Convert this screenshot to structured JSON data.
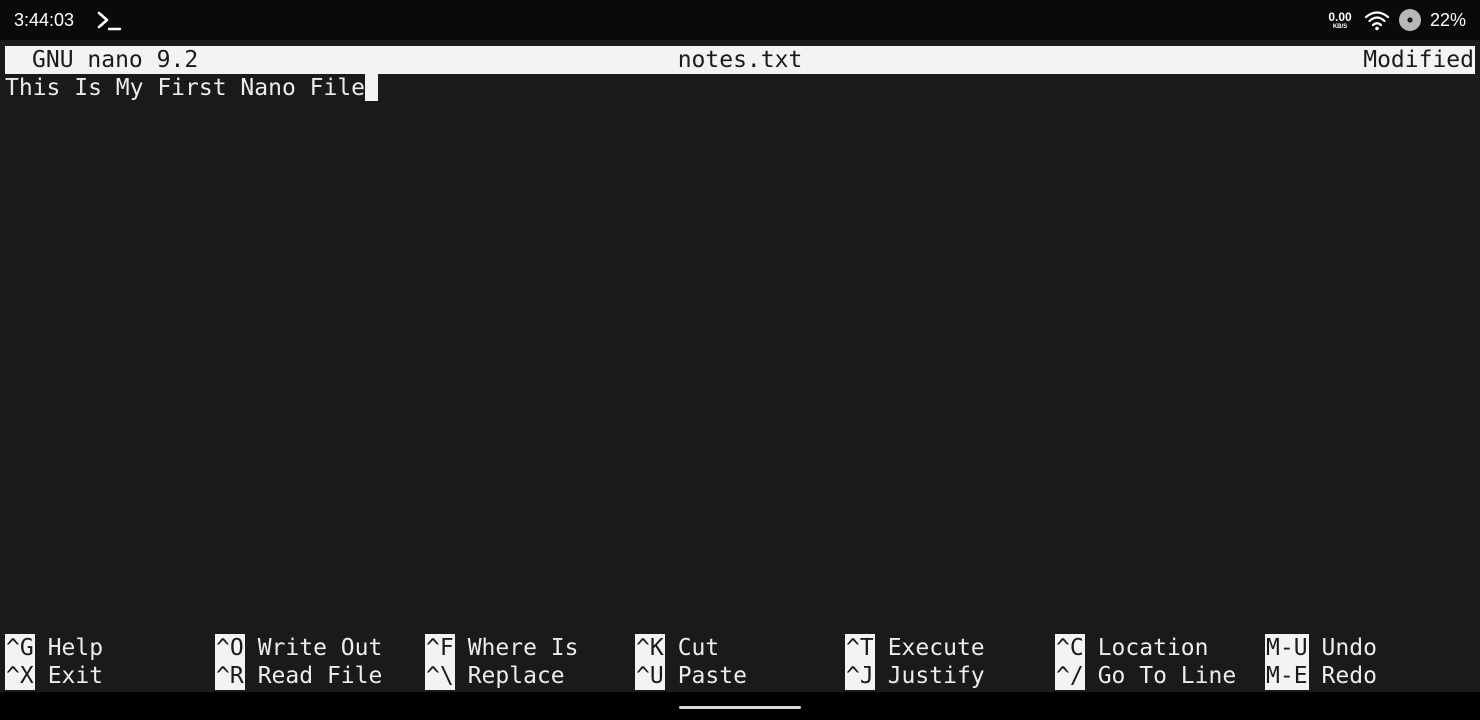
{
  "status_bar": {
    "time": "3:44:03",
    "net_speed_value": "0.00",
    "net_speed_unit": "KB/S",
    "battery": "22%",
    "icons": [
      "terminal-icon",
      "wifi-icon",
      "dot-icon"
    ]
  },
  "nano": {
    "title_left": "GNU nano 9.2",
    "filename": "notes.txt",
    "state": "Modified",
    "lines": [
      "This Is My First Nano File"
    ]
  },
  "shortcuts": [
    {
      "key": "^G",
      "label": "Help"
    },
    {
      "key": "^O",
      "label": "Write Out"
    },
    {
      "key": "^F",
      "label": "Where Is"
    },
    {
      "key": "^K",
      "label": "Cut"
    },
    {
      "key": "^T",
      "label": "Execute"
    },
    {
      "key": "^C",
      "label": "Location"
    },
    {
      "key": "M-U",
      "label": "Undo"
    },
    {
      "key": "^X",
      "label": "Exit"
    },
    {
      "key": "^R",
      "label": "Read File"
    },
    {
      "key": "^\\",
      "label": "Replace"
    },
    {
      "key": "^U",
      "label": "Paste"
    },
    {
      "key": "^J",
      "label": "Justify"
    },
    {
      "key": "^/",
      "label": "Go To Line"
    },
    {
      "key": "M-E",
      "label": "Redo"
    }
  ],
  "colors": {
    "terminal_bg": "#1a1a1a",
    "text": "#ececec",
    "inverse_bg": "#f3f3f3",
    "status_bar_bg": "#0a0a0a"
  }
}
